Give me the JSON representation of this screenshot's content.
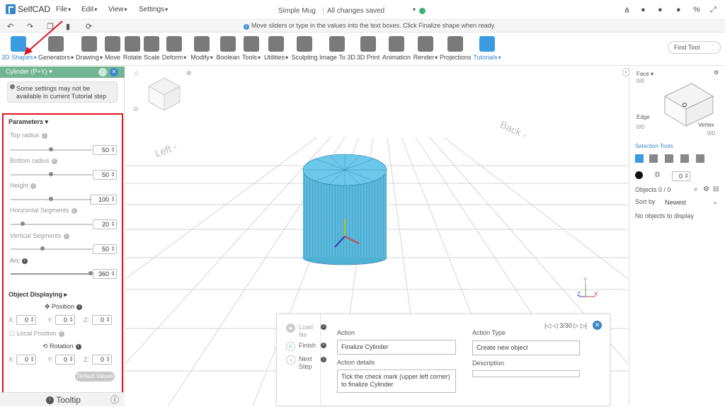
{
  "app": {
    "name": "SelfCAD",
    "doc_title": "Simple Mug",
    "save_status": "All changes saved"
  },
  "menu": {
    "file": "File",
    "edit": "Edit",
    "view": "View",
    "settings": "Settings"
  },
  "hint": "Move sliders or type in the values into the text boxes. Click Finalize shape when ready.",
  "tools": [
    {
      "label": "3D Shapes"
    },
    {
      "label": "Generators"
    },
    {
      "label": "Drawing"
    },
    {
      "label": "Move"
    },
    {
      "label": "Rotate"
    },
    {
      "label": "Scale"
    },
    {
      "label": "Deform"
    },
    {
      "label": "Modify"
    },
    {
      "label": "Boolean"
    },
    {
      "label": "Tools"
    },
    {
      "label": "Utilities"
    },
    {
      "label": "Sculpting"
    },
    {
      "label": "Image To 3D"
    },
    {
      "label": "3D Print"
    },
    {
      "label": "Animation"
    },
    {
      "label": "Render"
    },
    {
      "label": "Projections"
    },
    {
      "label": "Tutorials"
    }
  ],
  "find_tool": "Find Tool",
  "panel": {
    "title": "Cylinder (P+Y)",
    "warning": "Some settings may not be available in current Tutorial step",
    "parameters": "Parameters",
    "top_radius": {
      "label": "Top radius",
      "value": "50"
    },
    "bottom_radius": {
      "label": "Bottom radius",
      "value": "50"
    },
    "height": {
      "label": "Height",
      "value": "100"
    },
    "h_segments": {
      "label": "Horizontal Segments",
      "value": "20"
    },
    "v_segments": {
      "label": "Vertical Segments",
      "value": "50"
    },
    "arc": {
      "label": "Arc",
      "value": "360"
    },
    "object_displaying": "Object Displaying",
    "position": "Position",
    "local_position": "Local Position",
    "rotation": "Rotation",
    "axes": {
      "x": "X:",
      "y": "Y:",
      "z": "Z:"
    },
    "pos": {
      "x": "0",
      "y": "0",
      "z": "0"
    },
    "rot": {
      "x": "0",
      "y": "0",
      "z": "0"
    },
    "default_values": "Default Values",
    "tooltip": "Tooltip"
  },
  "viewport": {
    "left_label": "Left -",
    "back_label": "Back -"
  },
  "right": {
    "face": "Face",
    "face_count": "0/0",
    "edge": "Edge",
    "edge_count": "0/0",
    "vertex": "Vertex",
    "vertex_count": "0/0",
    "selection_tools": "Selection Tools",
    "num": "0",
    "objects": "Objects 0 / 0",
    "sort_by": "Sort by",
    "sort_value": "Newest",
    "empty": "No objects to display"
  },
  "action": {
    "steps": [
      "Load file",
      "Finish",
      "Next Step"
    ],
    "action_label": "Action",
    "action_value": "Finalize Cylinder",
    "details_label": "Action details",
    "details_value": "Tick the check mark (upper left corner) to finalize Cylinder",
    "type_label": "Action Type",
    "type_value": "Create new object",
    "desc_label": "Description",
    "desc_value": "",
    "pager": "3/30"
  }
}
